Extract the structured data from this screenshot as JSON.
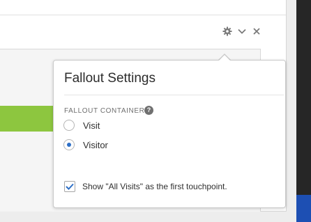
{
  "header": {
    "icons": [
      "gear-icon",
      "chevron-down-icon",
      "close-icon"
    ]
  },
  "popover": {
    "title": "Fallout Settings",
    "section_label": "FALLOUT CONTAINER",
    "help_icon_glyph": "?",
    "radio_options": [
      {
        "label": "Visit",
        "selected": false
      },
      {
        "label": "Visitor",
        "selected": true
      }
    ],
    "checkbox": {
      "label": "Show \"All Visits\" as the first touchpoint.",
      "checked": true
    }
  },
  "colors": {
    "accent": "#2d6fc6",
    "green_bar": "#8dc63f",
    "blue_bar": "#1d4fb3"
  }
}
